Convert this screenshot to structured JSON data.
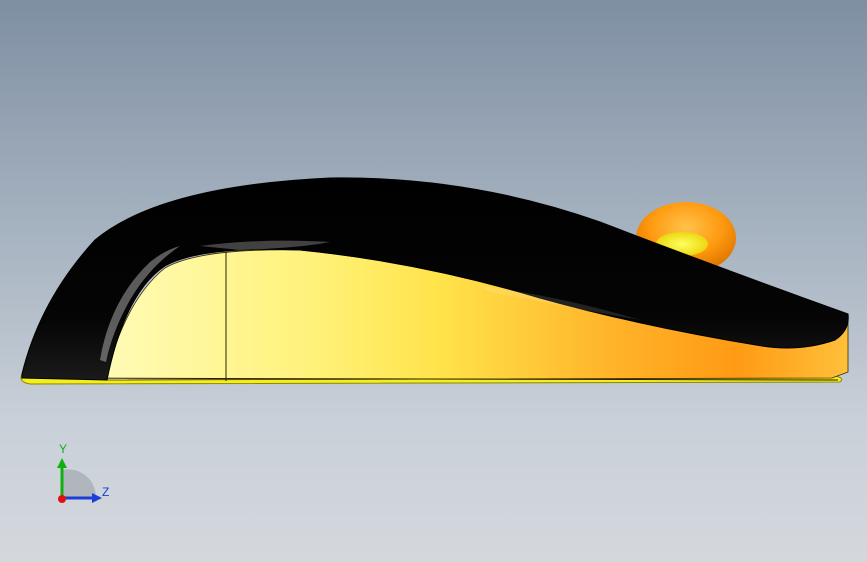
{
  "viewport": {
    "background_top": "#7f8fa3",
    "background_bottom": "#d4d8dd"
  },
  "model": {
    "name": "mouse-side-view",
    "body_color": "#000000",
    "side_panel_colors": [
      "#fffbb0",
      "#ffee40",
      "#ffa51c"
    ],
    "base_color": "#f3ee1e",
    "scroll_wheel_color": "#ff9a10"
  },
  "triad": {
    "y_label": "Y",
    "z_label": "Z",
    "y_color": "#10b010",
    "z_color": "#1c3ed6",
    "origin_color": "#e01010"
  }
}
